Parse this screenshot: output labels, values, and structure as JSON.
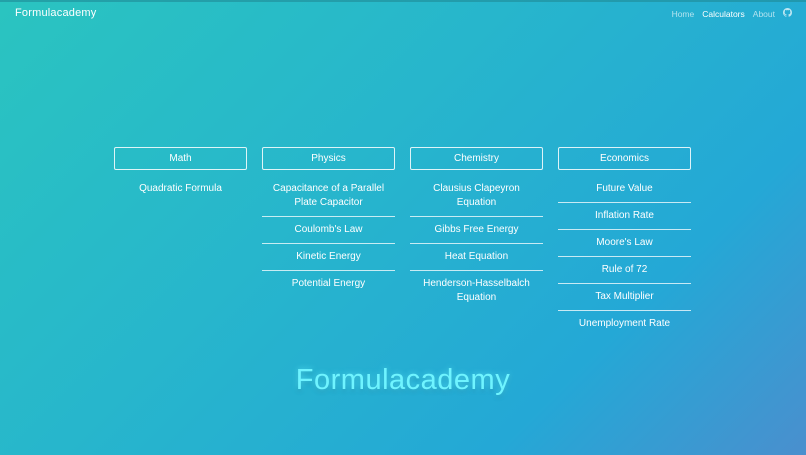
{
  "nav": {
    "brand": "Formulacademy",
    "links": [
      {
        "label": "Home",
        "active": false
      },
      {
        "label": "Calculators",
        "active": true
      },
      {
        "label": "About",
        "active": false
      }
    ],
    "icon": "github-icon"
  },
  "columns": [
    {
      "title": "Math",
      "items": [
        "Quadratic Formula"
      ]
    },
    {
      "title": "Physics",
      "items": [
        "Capacitance of a Parallel Plate Capacitor",
        "Coulomb's Law",
        "Kinetic Energy",
        "Potential Energy"
      ]
    },
    {
      "title": "Chemistry",
      "items": [
        "Clausius Clapeyron Equation",
        "Gibbs Free Energy",
        "Heat Equation",
        "Henderson-Hasselbalch Equation"
      ]
    },
    {
      "title": "Economics",
      "items": [
        "Future Value",
        "Inflation Rate",
        "Moore's Law",
        "Rule of 72",
        "Tax Multiplier",
        "Unemployment Rate"
      ]
    }
  ],
  "hero": {
    "title": "Formulacademy"
  },
  "colors": {
    "accent": "#6ff4ff",
    "bg_start": "#2ac4c0",
    "bg_end": "#4a8fce"
  }
}
